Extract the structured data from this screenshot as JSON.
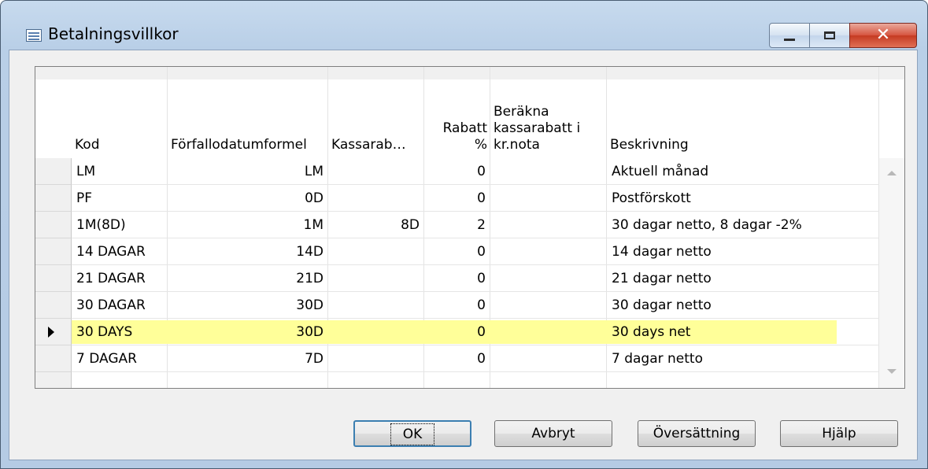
{
  "window": {
    "title": "Betalningsvillkor"
  },
  "grid": {
    "columns": [
      {
        "key": "kod",
        "label": "Kod"
      },
      {
        "key": "formel",
        "label": "Förfallodatumformel"
      },
      {
        "key": "kassarab",
        "label": "Kassarab…"
      },
      {
        "key": "rabatt",
        "label": "Rabatt\n%"
      },
      {
        "key": "berakna",
        "label": "Beräkna\nkassarabatt i\nkr.nota"
      },
      {
        "key": "beskrivning",
        "label": "Beskrivning"
      }
    ],
    "rows": [
      {
        "kod": "LM",
        "formel": "LM",
        "kassarab": "",
        "rabatt": "0",
        "berakna": "",
        "beskrivning": "Aktuell månad"
      },
      {
        "kod": "PF",
        "formel": "0D",
        "kassarab": "",
        "rabatt": "0",
        "berakna": "",
        "beskrivning": "Postförskott"
      },
      {
        "kod": "1M(8D)",
        "formel": "1M",
        "kassarab": "8D",
        "rabatt": "2",
        "berakna": "",
        "beskrivning": "30 dagar netto, 8 dagar -2%"
      },
      {
        "kod": "14 DAGAR",
        "formel": "14D",
        "kassarab": "",
        "rabatt": "0",
        "berakna": "",
        "beskrivning": "14 dagar netto"
      },
      {
        "kod": "21 DAGAR",
        "formel": "21D",
        "kassarab": "",
        "rabatt": "0",
        "berakna": "",
        "beskrivning": "21 dagar netto"
      },
      {
        "kod": "30 DAGAR",
        "formel": "30D",
        "kassarab": "",
        "rabatt": "0",
        "berakna": "",
        "beskrivning": "30 dagar netto"
      },
      {
        "kod": "30 DAYS",
        "formel": "30D",
        "kassarab": "",
        "rabatt": "0",
        "berakna": "",
        "beskrivning": "30 days net",
        "selected": true
      },
      {
        "kod": "7 DAGAR",
        "formel": "7D",
        "kassarab": "",
        "rabatt": "0",
        "berakna": "",
        "beskrivning": "7 dagar netto"
      }
    ],
    "highlight_color": "#ffff99"
  },
  "buttons": {
    "ok": "OK",
    "cancel": "Avbryt",
    "translation": "Översättning",
    "help": "Hjälp"
  },
  "icons": {
    "app": "table-icon",
    "minimize": "minimize-icon",
    "maximize": "maximize-icon",
    "close": "close-icon"
  }
}
